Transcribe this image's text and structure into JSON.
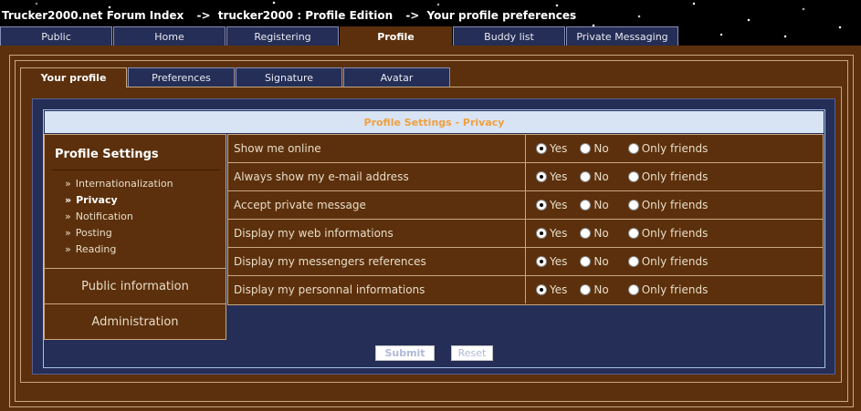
{
  "breadcrumb": {
    "items": [
      "Trucker2000.net Forum Index",
      "->",
      "trucker2000 : Profile Edition",
      "->",
      "Your profile preferences"
    ]
  },
  "topnav": {
    "tabs": [
      {
        "label": "Public"
      },
      {
        "label": "Home"
      },
      {
        "label": "Registering"
      },
      {
        "label": "Profile",
        "active": true
      },
      {
        "label": "Buddy list"
      },
      {
        "label": "Private Messaging"
      }
    ]
  },
  "subnav": {
    "tabs": [
      {
        "label": "Your profile",
        "active": true
      },
      {
        "label": "Preferences"
      },
      {
        "label": "Signature"
      },
      {
        "label": "Avatar"
      }
    ]
  },
  "panel": {
    "title": "Profile Settings - Privacy"
  },
  "sidebar": {
    "section_title": "Profile Settings",
    "bullet": "»",
    "items": [
      {
        "label": "Internationalization"
      },
      {
        "label": "Privacy",
        "active": true
      },
      {
        "label": "Notification"
      },
      {
        "label": "Posting"
      },
      {
        "label": "Reading"
      }
    ],
    "blocks": [
      {
        "label": "Public information"
      },
      {
        "label": "Administration"
      }
    ]
  },
  "options": {
    "yes": "Yes",
    "no": "No",
    "friends": "Only friends"
  },
  "rows": [
    {
      "label": "Show me online",
      "selected": "yes"
    },
    {
      "label": "Always show my e-mail address",
      "selected": "yes"
    },
    {
      "label": "Accept private message",
      "selected": "yes"
    },
    {
      "label": "Display my web informations",
      "selected": "yes"
    },
    {
      "label": "Display my messengers references",
      "selected": "yes"
    },
    {
      "label": "Display my personnal informations",
      "selected": "yes"
    }
  ],
  "buttons": {
    "submit": "Submit",
    "reset": "Reset"
  },
  "colors": {
    "brown": "#5c300c",
    "navy": "#242e56",
    "title_bg": "#d8e4f4",
    "title_text": "#f0a040"
  }
}
